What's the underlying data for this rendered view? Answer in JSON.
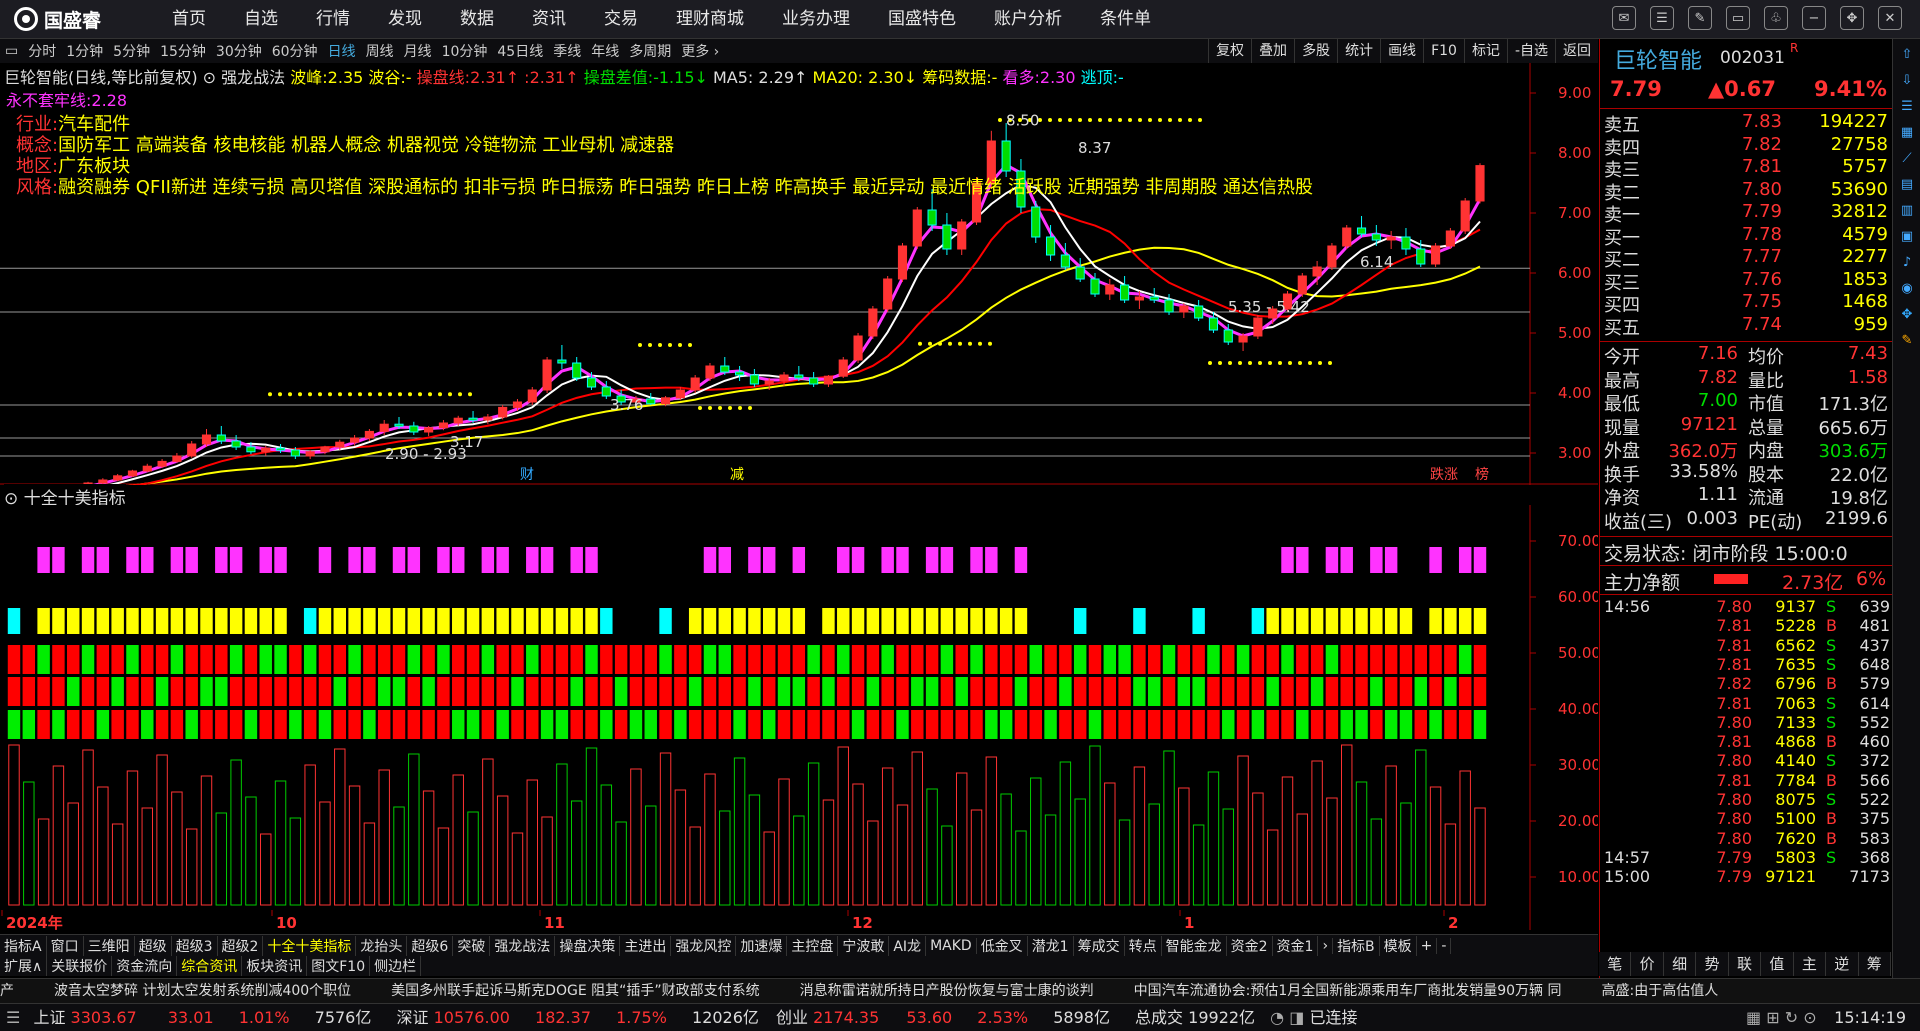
{
  "app": {
    "logo_text": "国盛睿"
  },
  "menu": [
    "首页",
    "自选",
    "行情",
    "发现",
    "数据",
    "资讯",
    "交易",
    "理财商城",
    "业务办理",
    "国盛特色",
    "账户分析",
    "条件单"
  ],
  "periods": [
    "分时",
    "1分钟",
    "5分钟",
    "15分钟",
    "30分钟",
    "60分钟",
    "日线",
    "周线",
    "月线",
    "10分钟",
    "45日线",
    "季线",
    "年线",
    "多周期",
    "更多 ›"
  ],
  "right_tools": [
    "复权",
    "叠加",
    "多股",
    "统计",
    "画线",
    "F10",
    "标记",
    "-自选",
    "返回"
  ],
  "stock": {
    "name": "巨轮智能",
    "code": "002031",
    "mark": "R",
    "price": "7.79",
    "change": "▲0.67",
    "pct": "9.41%"
  },
  "header": {
    "title": "巨轮智能(日线,等比前复权)",
    "strategy": "强龙战法",
    "bofeng": "波峰:2.35",
    "bogu": "波谷:-",
    "caopan": "操盘线:2.31↑ :2.31↑",
    "caopan_diff": "操盘差值:-1.15↓",
    "ma5": "MA5: 2.29↑",
    "ma20": "MA20: 2.30↓",
    "chouma": "筹码数据:-",
    "kanduo": "看多:2.30",
    "xuanxiang": "逃顶:-",
    "yongbu": "永不套牢线:2.28"
  },
  "info": {
    "industry_label": "行业:",
    "industry": "汽车配件",
    "concept_label": "概念:",
    "concept": "国防军工 高端装备 核电核能 机器人概念 机器视觉 冷链物流 工业母机 减速器",
    "region_label": "地区:",
    "region": "广东板块",
    "style_label": "风格:",
    "style": "融资融券 QFII新进 连续亏损 高贝塔值 深股通标的 扣非亏损 昨日振荡 昨日强势 昨日上榜 昨高换手 最近异动 最近情绪 活跃股 近期强势 非周期股 通达信热股"
  },
  "indicator_title": "十全十美指标",
  "chart_data": {
    "type": "candlestick",
    "ylim": [
      2.5,
      9.5
    ],
    "yticks": [
      "9.00",
      "8.00",
      "7.00",
      "6.00",
      "5.00",
      "4.00",
      "3.00"
    ],
    "xlabels": [
      "2024年",
      "10",
      "11",
      "12",
      "1",
      "2"
    ],
    "annotations": [
      "8.50",
      "2.90 - 2.93",
      "3.17",
      "3.76",
      "5.35 - 5.42",
      "6.14",
      "8.37"
    ],
    "markers": [
      "财",
      "减",
      "跌涨",
      "榜"
    ],
    "ind_ylim": [
      5,
      80
    ],
    "ind_yticks": [
      "70.00",
      "60.00",
      "50.00",
      "40.00",
      "30.00",
      "20.00",
      "10.00"
    ],
    "ohlc": [
      [
        2.3,
        2.34,
        2.27,
        2.31
      ],
      [
        2.31,
        2.33,
        2.26,
        2.28
      ],
      [
        2.28,
        2.36,
        2.27,
        2.35
      ],
      [
        2.35,
        2.4,
        2.32,
        2.38
      ],
      [
        2.38,
        2.45,
        2.36,
        2.44
      ],
      [
        2.44,
        2.52,
        2.42,
        2.5
      ],
      [
        2.5,
        2.58,
        2.48,
        2.55
      ],
      [
        2.55,
        2.65,
        2.53,
        2.62
      ],
      [
        2.62,
        2.72,
        2.6,
        2.7
      ],
      [
        2.7,
        2.82,
        2.68,
        2.78
      ],
      [
        2.78,
        2.9,
        2.75,
        2.86
      ],
      [
        2.86,
        3.0,
        2.84,
        2.95
      ],
      [
        2.95,
        3.2,
        2.92,
        3.15
      ],
      [
        3.15,
        3.4,
        3.1,
        3.3
      ],
      [
        3.3,
        3.45,
        3.15,
        3.2
      ],
      [
        3.2,
        3.3,
        3.05,
        3.1
      ],
      [
        3.1,
        3.18,
        2.98,
        3.02
      ],
      [
        3.02,
        3.12,
        2.95,
        3.08
      ],
      [
        3.08,
        3.15,
        3.0,
        3.05
      ],
      [
        3.05,
        3.1,
        2.9,
        2.95
      ],
      [
        2.95,
        3.05,
        2.9,
        3.02
      ],
      [
        3.02,
        3.12,
        2.98,
        3.1
      ],
      [
        3.1,
        3.22,
        3.05,
        3.18
      ],
      [
        3.18,
        3.3,
        3.12,
        3.25
      ],
      [
        3.25,
        3.4,
        3.2,
        3.36
      ],
      [
        3.36,
        3.55,
        3.3,
        3.48
      ],
      [
        3.48,
        3.6,
        3.4,
        3.45
      ],
      [
        3.45,
        3.52,
        3.3,
        3.35
      ],
      [
        3.35,
        3.45,
        3.28,
        3.42
      ],
      [
        3.42,
        3.55,
        3.38,
        3.5
      ],
      [
        3.5,
        3.62,
        3.45,
        3.58
      ],
      [
        3.58,
        3.7,
        3.5,
        3.55
      ],
      [
        3.55,
        3.65,
        3.48,
        3.6
      ],
      [
        3.6,
        3.8,
        3.56,
        3.76
      ],
      [
        3.76,
        3.9,
        3.7,
        3.85
      ],
      [
        3.85,
        4.1,
        3.8,
        4.05
      ],
      [
        4.05,
        4.6,
        4.0,
        4.55
      ],
      [
        4.55,
        4.8,
        4.4,
        4.5
      ],
      [
        4.5,
        4.6,
        4.2,
        4.25
      ],
      [
        4.25,
        4.35,
        4.05,
        4.1
      ],
      [
        4.1,
        4.2,
        3.9,
        3.95
      ],
      [
        3.95,
        4.05,
        3.8,
        3.85
      ],
      [
        3.85,
        3.95,
        3.75,
        3.9
      ],
      [
        3.9,
        4.0,
        3.8,
        3.82
      ],
      [
        3.82,
        3.95,
        3.78,
        3.92
      ],
      [
        3.92,
        4.1,
        3.88,
        4.05
      ],
      [
        4.05,
        4.3,
        4.0,
        4.25
      ],
      [
        4.25,
        4.5,
        4.2,
        4.45
      ],
      [
        4.45,
        4.6,
        4.3,
        4.35
      ],
      [
        4.35,
        4.45,
        4.2,
        4.3
      ],
      [
        4.3,
        4.4,
        4.1,
        4.15
      ],
      [
        4.15,
        4.25,
        4.05,
        4.2
      ],
      [
        4.2,
        4.35,
        4.12,
        4.3
      ],
      [
        4.3,
        4.45,
        4.2,
        4.25
      ],
      [
        4.25,
        4.35,
        4.1,
        4.15
      ],
      [
        4.15,
        4.3,
        4.1,
        4.28
      ],
      [
        4.28,
        4.6,
        4.25,
        4.55
      ],
      [
        4.55,
        5.0,
        4.5,
        4.95
      ],
      [
        4.95,
        5.45,
        4.9,
        5.4
      ],
      [
        5.4,
        5.95,
        5.35,
        5.9
      ],
      [
        5.9,
        6.5,
        5.85,
        6.45
      ],
      [
        6.45,
        7.1,
        6.4,
        7.05
      ],
      [
        7.05,
        7.4,
        6.7,
        6.8
      ],
      [
        6.8,
        7.0,
        6.3,
        6.4
      ],
      [
        6.4,
        6.9,
        6.3,
        6.85
      ],
      [
        6.85,
        7.6,
        6.8,
        7.5
      ],
      [
        7.5,
        8.37,
        7.4,
        8.2
      ],
      [
        8.2,
        8.5,
        7.6,
        7.7
      ],
      [
        7.7,
        7.9,
        7.0,
        7.1
      ],
      [
        7.1,
        7.2,
        6.5,
        6.6
      ],
      [
        6.6,
        6.8,
        6.2,
        6.3
      ],
      [
        6.3,
        6.5,
        6.05,
        6.1
      ],
      [
        6.1,
        6.25,
        5.85,
        5.9
      ],
      [
        5.9,
        6.0,
        5.6,
        5.65
      ],
      [
        5.65,
        5.9,
        5.55,
        5.8
      ],
      [
        5.8,
        5.95,
        5.5,
        5.55
      ],
      [
        5.55,
        5.7,
        5.4,
        5.6
      ],
      [
        5.6,
        5.75,
        5.5,
        5.55
      ],
      [
        5.55,
        5.65,
        5.3,
        5.35
      ],
      [
        5.35,
        5.5,
        5.25,
        5.45
      ],
      [
        5.45,
        5.55,
        5.2,
        5.25
      ],
      [
        5.25,
        5.35,
        5.0,
        5.05
      ],
      [
        5.05,
        5.15,
        4.8,
        4.85
      ],
      [
        4.85,
        5.0,
        4.7,
        4.95
      ],
      [
        4.95,
        5.3,
        4.9,
        5.25
      ],
      [
        5.25,
        5.45,
        5.15,
        5.4
      ],
      [
        5.4,
        5.7,
        5.35,
        5.65
      ],
      [
        5.65,
        6.0,
        5.6,
        5.95
      ],
      [
        5.95,
        6.2,
        5.8,
        6.1
      ],
      [
        6.1,
        6.5,
        6.05,
        6.45
      ],
      [
        6.45,
        6.8,
        6.4,
        6.75
      ],
      [
        6.75,
        6.95,
        6.6,
        6.65
      ],
      [
        6.65,
        6.8,
        6.45,
        6.55
      ],
      [
        6.55,
        6.7,
        6.4,
        6.6
      ],
      [
        6.6,
        6.75,
        6.3,
        6.4
      ],
      [
        6.4,
        6.55,
        6.1,
        6.15
      ],
      [
        6.15,
        6.5,
        6.1,
        6.45
      ],
      [
        6.45,
        6.75,
        6.4,
        6.7
      ],
      [
        6.7,
        7.25,
        6.65,
        7.2
      ],
      [
        7.2,
        7.83,
        7.16,
        7.79
      ]
    ],
    "ind_rows": [
      {
        "name": "magenta",
        "color": "#ff33ff"
      },
      {
        "name": "yellow",
        "color": "#ffff00"
      },
      {
        "name": "red-green-1",
        "color": "#ff0000"
      },
      {
        "name": "red-green-2",
        "color": "#ff0000"
      },
      {
        "name": "red-green-3",
        "color": "#ff0000"
      }
    ]
  },
  "quote": {
    "sells": [
      [
        "卖五",
        "7.83",
        "194227"
      ],
      [
        "卖四",
        "7.82",
        "27758"
      ],
      [
        "卖三",
        "7.81",
        "5757"
      ],
      [
        "卖二",
        "7.80",
        "53690"
      ],
      [
        "卖一",
        "7.79",
        "32812"
      ]
    ],
    "buys": [
      [
        "买一",
        "7.78",
        "4579"
      ],
      [
        "买二",
        "7.77",
        "2277"
      ],
      [
        "买三",
        "7.76",
        "1853"
      ],
      [
        "买四",
        "7.75",
        "1468"
      ],
      [
        "买五",
        "7.74",
        "959"
      ]
    ],
    "stats": [
      [
        "今开",
        "7.16",
        "均价",
        "7.43"
      ],
      [
        "最高",
        "7.82",
        "量比",
        "1.58"
      ],
      [
        "最低",
        "7.00",
        "市值",
        "171.3亿"
      ],
      [
        "现量",
        "97121",
        "总量",
        "665.6万"
      ],
      [
        "外盘",
        "362.0万",
        "内盘",
        "303.6万"
      ],
      [
        "换手",
        "33.58%",
        "股本",
        "22.0亿"
      ],
      [
        "净资",
        "1.11",
        "流通",
        "19.8亿"
      ],
      [
        "收益(三)",
        "0.003",
        "PE(动)",
        "2199.6"
      ]
    ],
    "trade_state": "交易状态: 闭市阶段 15:00:0",
    "main_net_label": "主力净额",
    "main_net": "2.73亿",
    "main_net_pct": "6%"
  },
  "ticks": [
    [
      "14:56",
      "7.80",
      "9137",
      "S",
      "639"
    ],
    [
      "",
      "7.81",
      "5228",
      "B",
      "481"
    ],
    [
      "",
      "7.81",
      "6562",
      "S",
      "437"
    ],
    [
      "",
      "7.81",
      "7635",
      "S",
      "648"
    ],
    [
      "",
      "7.82",
      "6796",
      "B",
      "579"
    ],
    [
      "",
      "7.81",
      "7063",
      "S",
      "614"
    ],
    [
      "",
      "7.80",
      "7133",
      "S",
      "552"
    ],
    [
      "",
      "7.81",
      "4868",
      "B",
      "460"
    ],
    [
      "",
      "7.80",
      "4140",
      "S",
      "372"
    ],
    [
      "",
      "7.81",
      "7784",
      "B",
      "566"
    ],
    [
      "",
      "7.80",
      "8075",
      "S",
      "522"
    ],
    [
      "",
      "7.80",
      "5100",
      "B",
      "375"
    ],
    [
      "",
      "7.80",
      "7620",
      "B",
      "583"
    ],
    [
      "14:57",
      "7.79",
      "5803",
      "S",
      "368"
    ],
    [
      "15:00",
      "7.79",
      "97121",
      "",
      "7173"
    ]
  ],
  "tabs1": [
    "指标A",
    "窗口",
    "三维阳",
    "超级",
    "超级3",
    "超级2",
    "十全十美指标",
    "龙抬头",
    "超级6",
    "突破",
    "强龙战法",
    "操盘决策",
    "主进出",
    "强龙风控",
    "加速爆",
    "主控盘",
    "宁波敢",
    "AI龙",
    "MAKD",
    "低金叉",
    "潜龙1",
    "筹成交",
    "转点",
    "智能金龙",
    "资金2",
    "资金1",
    "›",
    "指标B",
    "模板",
    "+",
    "-"
  ],
  "tabs2": [
    "扩展∧",
    "关联报价",
    "资金流向",
    "综合资讯",
    "板块资讯",
    "图文F10",
    "侧边栏"
  ],
  "rtabs": [
    "笔",
    "价",
    "细",
    "势",
    "联",
    "值",
    "主",
    "逆",
    "筹"
  ],
  "news": [
    "产",
    "波音太空梦碎 计划太空发射系统削减400个职位",
    "美国多州联手起诉马斯克DOGE 阻其“插手”财政部支付系统",
    "消息称雷诺就所持日产股份恢复与富士康的谈判",
    "中国汽车流通协会:预估1月全国新能源乘用车厂商批发销量90万辆 同",
    "高盛:由于高估值人"
  ],
  "status": {
    "sh_label": "上证",
    "sh": "3303.67",
    "sh_chg": "33.01",
    "sh_pct": "1.01%",
    "sh_amt": "7576亿",
    "sz_label": "深证",
    "sz": "10576.00",
    "sz_chg": "182.37",
    "sz_pct": "1.75%",
    "sz_amt": "12026亿",
    "cy_label": "创业",
    "cy": "2174.35",
    "cy_chg": "53.60",
    "cy_pct": "2.53%",
    "cy_amt": "5898亿",
    "total_label": "总成交",
    "total": "19922亿",
    "conn": "已连接",
    "time": "15:14:19"
  },
  "colors": {
    "up": "#ff3333",
    "down": "#00dd00",
    "bg": "#000000",
    "grid": "#aa0000"
  }
}
